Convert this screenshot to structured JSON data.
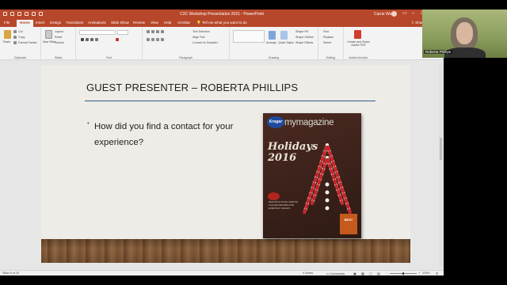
{
  "window": {
    "title": "C2C Workshop Presentation 2021  -  PowerPoint",
    "user": "Carrie Wiant"
  },
  "tabs": [
    "File",
    "Home",
    "Insert",
    "Design",
    "Transitions",
    "Animations",
    "Slide Show",
    "Review",
    "View",
    "Help",
    "Acrobat"
  ],
  "active_tab": "Home",
  "tellme": "Tell me what you want to do",
  "share": "Share",
  "ribbon": {
    "groups": [
      "Clipboard",
      "Slides",
      "Font",
      "Paragraph",
      "Drawing",
      "Editing",
      "Adobe Acrobat"
    ],
    "paste": "Paste",
    "cut": "Cut",
    "copy": "Copy",
    "format_painter": "Format Painter",
    "new_slide": "New Slide",
    "layout": "Layout",
    "reset": "Reset",
    "section": "Section",
    "text_direction": "Text Direction",
    "align_text": "Align Text",
    "convert_smartart": "Convert to SmartArt",
    "arrange": "Arrange",
    "quick_styles": "Quick Styles",
    "shape_fill": "Shape Fill",
    "shape_outline": "Shape Outline",
    "shape_effects": "Shape Effects",
    "find": "Find",
    "replace": "Replace",
    "select": "Select",
    "create_share": "Create and Share Adobe PDF"
  },
  "slide": {
    "title": "GUEST PRESENTER – ROBERTA PHILLIPS",
    "bullet": "How did you find a contact for your experience?",
    "magazine": {
      "logo": "Kroger",
      "name": "mymagazine",
      "headline": "Holidays 2016",
      "subtext": "DELICIOUS FOOD, FESTIVE FUN AND RECIPES FOR EVERYDAY SNACKS",
      "badge": "BEST"
    }
  },
  "status": {
    "slide_info": "Slide 8 of 19",
    "notes": "Notes",
    "comments": "Comments",
    "zoom": "119%"
  },
  "webcam": {
    "name": "Roberta Phillips"
  },
  "colors": {
    "accent": "#b7472a",
    "rule": "#2e5a88"
  }
}
